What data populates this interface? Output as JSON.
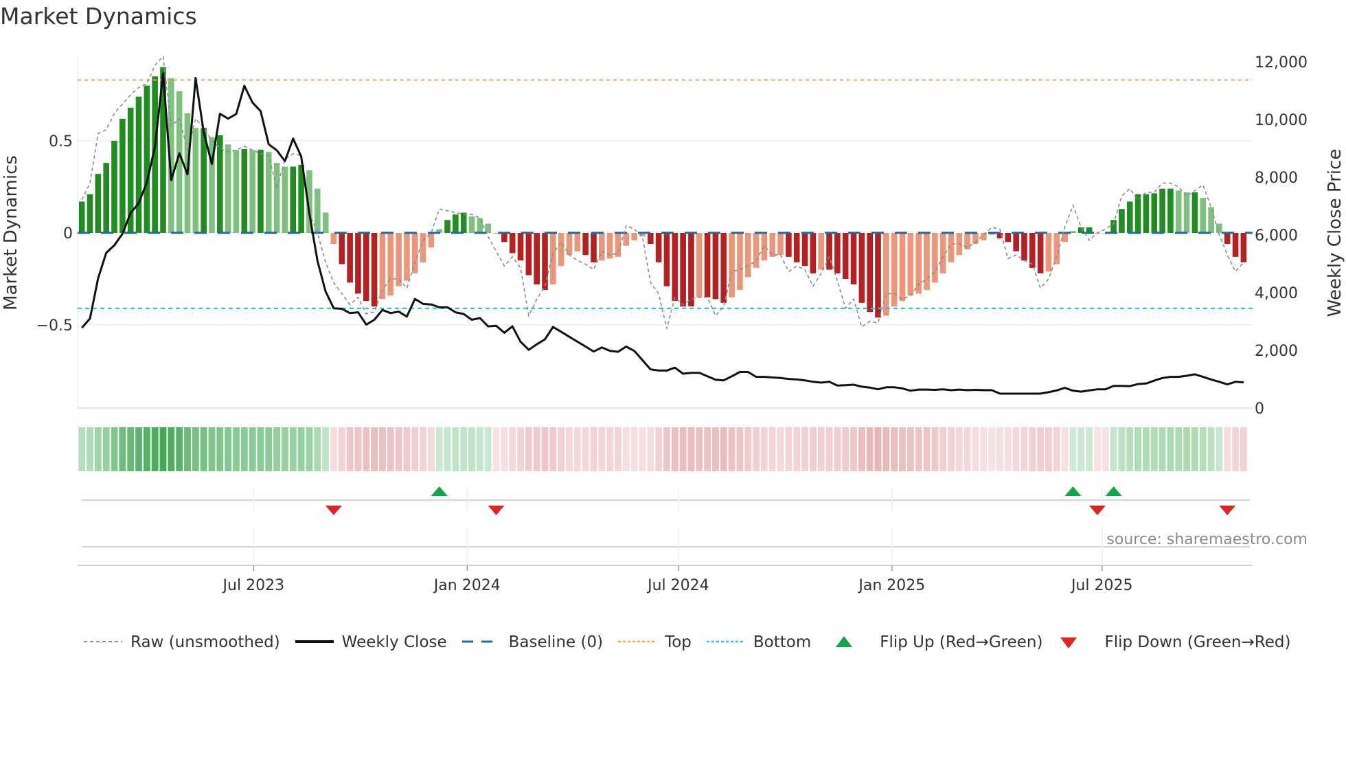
{
  "title": "Market Dynamics",
  "source": "source: sharemaestro.com",
  "colors": {
    "green_strong": "#228b22",
    "green_weak": "#7fbf7f",
    "red_strong": "#b22222",
    "red_weak": "#e9967a",
    "close": "#111111",
    "raw": "#8c8c8c",
    "baseline": "#1f6aa5",
    "top": "#f4a261",
    "bottom": "#2ec4d6",
    "flip_up": "#16a34a",
    "flip_down": "#dc2626"
  },
  "legend": [
    {
      "key": "raw",
      "label": "Raw (unsmoothed)"
    },
    {
      "key": "close",
      "label": "Weekly Close"
    },
    {
      "key": "baseline",
      "label": "Baseline (0)"
    },
    {
      "key": "top",
      "label": "Top"
    },
    {
      "key": "bottom",
      "label": "Bottom"
    },
    {
      "key": "flip_up",
      "label": "Flip Up (Red→Green)"
    },
    {
      "key": "flip_down",
      "label": "Flip Down (Green→Red)"
    }
  ],
  "chart_data": {
    "type": "bar",
    "title": "Market Dynamics",
    "ylabel": "Market Dynamics",
    "y2label": "Weekly Close Price",
    "ylim": [
      -0.96,
      0.98
    ],
    "y2lim": [
      0,
      12500
    ],
    "yticks": [
      {
        "v": 0.5,
        "label": "0.5"
      },
      {
        "v": 0,
        "label": "0"
      },
      {
        "v": -0.5,
        "label": "−0.5"
      }
    ],
    "y2ticks": [
      {
        "v": 12000,
        "label": "12,000"
      },
      {
        "v": 10000,
        "label": "10,000"
      },
      {
        "v": 8000,
        "label": "8,000"
      },
      {
        "v": 6000,
        "label": "6,000"
      },
      {
        "v": 4000,
        "label": "4,000"
      },
      {
        "v": 2000,
        "label": "2,000"
      },
      {
        "v": 0,
        "label": "0"
      }
    ],
    "xticks": [
      {
        "date": "2023-07-01",
        "label": "Jul 2023"
      },
      {
        "date": "2024-01-01",
        "label": "Jan 2024"
      },
      {
        "date": "2024-07-01",
        "label": "Jul 2024"
      },
      {
        "date": "2025-01-01",
        "label": "Jan 2025"
      },
      {
        "date": "2025-07-01",
        "label": "Jul 2025"
      }
    ],
    "start_date": "2023-02-03",
    "interval_days": 7,
    "top": 0.83,
    "bottom": -0.41,
    "baseline": 0,
    "momentum": [
      0.17,
      0.21,
      0.32,
      0.38,
      0.5,
      0.62,
      0.68,
      0.74,
      0.8,
      0.85,
      0.9,
      0.84,
      0.77,
      0.65,
      0.57,
      0.57,
      0.52,
      0.53,
      0.48,
      0.45,
      0.455,
      0.45,
      0.452,
      0.44,
      0.38,
      0.36,
      0.36,
      0.37,
      0.34,
      0.24,
      0.11,
      -0.06,
      -0.17,
      -0.27,
      -0.33,
      -0.37,
      -0.4,
      -0.36,
      -0.34,
      -0.29,
      -0.26,
      -0.22,
      -0.16,
      -0.08,
      0.02,
      0.07,
      0.1,
      0.11,
      0.09,
      0.08,
      0.05,
      -0.005,
      -0.05,
      -0.11,
      -0.15,
      -0.23,
      -0.28,
      -0.31,
      -0.28,
      -0.18,
      -0.12,
      -0.1,
      -0.12,
      -0.16,
      -0.15,
      -0.14,
      -0.13,
      -0.07,
      -0.04,
      -0.02,
      -0.06,
      -0.16,
      -0.29,
      -0.37,
      -0.4,
      -0.4,
      -0.35,
      -0.35,
      -0.36,
      -0.38,
      -0.35,
      -0.31,
      -0.24,
      -0.19,
      -0.15,
      -0.13,
      -0.12,
      -0.13,
      -0.16,
      -0.18,
      -0.22,
      -0.2,
      -0.2,
      -0.22,
      -0.25,
      -0.28,
      -0.38,
      -0.43,
      -0.46,
      -0.45,
      -0.4,
      -0.37,
      -0.34,
      -0.33,
      -0.31,
      -0.27,
      -0.22,
      -0.16,
      -0.12,
      -0.09,
      -0.06,
      -0.04,
      -0.01,
      -0.03,
      -0.05,
      -0.1,
      -0.15,
      -0.19,
      -0.22,
      -0.21,
      -0.17,
      -0.05,
      0.01,
      0.03,
      0.03,
      -0.005,
      -0.003,
      0.07,
      0.13,
      0.17,
      0.21,
      0.21,
      0.215,
      0.24,
      0.24,
      0.23,
      0.22,
      0.22,
      0.19,
      0.14,
      0.05,
      -0.06,
      -0.13,
      -0.16
    ],
    "raw": [
      0.18,
      0.27,
      0.54,
      0.56,
      0.65,
      0.7,
      0.75,
      0.79,
      0.81,
      0.91,
      0.96,
      0.58,
      0.62,
      0.45,
      0.62,
      0.57,
      0.5,
      0.46,
      0.44,
      0.45,
      0.47,
      0.45,
      0.43,
      0.42,
      0.24,
      0.4,
      0.43,
      0.42,
      0.11,
      0.0,
      -0.16,
      -0.27,
      -0.33,
      -0.39,
      -0.35,
      -0.44,
      -0.43,
      -0.31,
      -0.25,
      -0.25,
      -0.3,
      -0.16,
      -0.04,
      0.0,
      0.13,
      0.12,
      0.11,
      0.1,
      0.1,
      0.08,
      -0.02,
      -0.1,
      -0.18,
      -0.13,
      -0.19,
      -0.45,
      -0.36,
      -0.29,
      -0.11,
      -0.05,
      -0.12,
      -0.15,
      -0.17,
      -0.2,
      -0.1,
      -0.12,
      -0.11,
      0.04,
      0.02,
      -0.02,
      -0.27,
      -0.33,
      -0.52,
      -0.35,
      -0.39,
      -0.36,
      -0.35,
      -0.35,
      -0.45,
      -0.4,
      -0.21,
      -0.2,
      -0.18,
      -0.15,
      -0.07,
      -0.12,
      -0.12,
      -0.21,
      -0.18,
      -0.2,
      -0.29,
      -0.22,
      -0.13,
      -0.26,
      -0.41,
      -0.36,
      -0.51,
      -0.48,
      -0.49,
      -0.33,
      -0.33,
      -0.36,
      -0.34,
      -0.28,
      -0.25,
      -0.21,
      -0.13,
      -0.06,
      -0.06,
      -0.08,
      -0.05,
      -0.01,
      0.03,
      0.02,
      -0.14,
      -0.12,
      -0.15,
      -0.17,
      -0.3,
      -0.25,
      -0.13,
      0.03,
      0.15,
      0.03,
      -0.04,
      0.0,
      0.02,
      0.05,
      0.2,
      0.24,
      0.18,
      0.22,
      0.22,
      0.27,
      0.27,
      0.25,
      0.2,
      0.23,
      0.26,
      0.14,
      -0.01,
      -0.12,
      -0.21,
      -0.16
    ],
    "close": [
      2780,
      3100,
      4500,
      5380,
      5640,
      6040,
      6760,
      7100,
      7820,
      9060,
      11600,
      7900,
      8830,
      8100,
      11440,
      9570,
      8460,
      10200,
      10030,
      10190,
      11170,
      10590,
      10290,
      9140,
      8930,
      8560,
      9340,
      8720,
      6760,
      5100,
      4040,
      3460,
      3440,
      3290,
      3320,
      2890,
      3060,
      3400,
      3290,
      3340,
      3170,
      3780,
      3610,
      3590,
      3490,
      3490,
      3320,
      3260,
      3060,
      3120,
      2830,
      2850,
      2610,
      2830,
      2300,
      2020,
      2210,
      2380,
      2810,
      2640,
      2470,
      2300,
      2130,
      1960,
      2100,
      1980,
      1950,
      2130,
      1980,
      1660,
      1340,
      1300,
      1300,
      1400,
      1190,
      1220,
      1220,
      1100,
      980,
      960,
      1100,
      1250,
      1250,
      1080,
      1080,
      1060,
      1040,
      1010,
      990,
      960,
      910,
      880,
      910,
      780,
      790,
      810,
      740,
      710,
      650,
      720,
      720,
      680,
      600,
      640,
      640,
      630,
      650,
      620,
      640,
      620,
      630,
      620,
      620,
      500,
      500,
      500,
      500,
      500,
      500,
      550,
      610,
      700,
      600,
      570,
      610,
      650,
      650,
      770,
      770,
      760,
      830,
      850,
      950,
      1040,
      1080,
      1080,
      1120,
      1170,
      1080,
      990,
      910,
      820,
      910,
      890
    ]
  }
}
